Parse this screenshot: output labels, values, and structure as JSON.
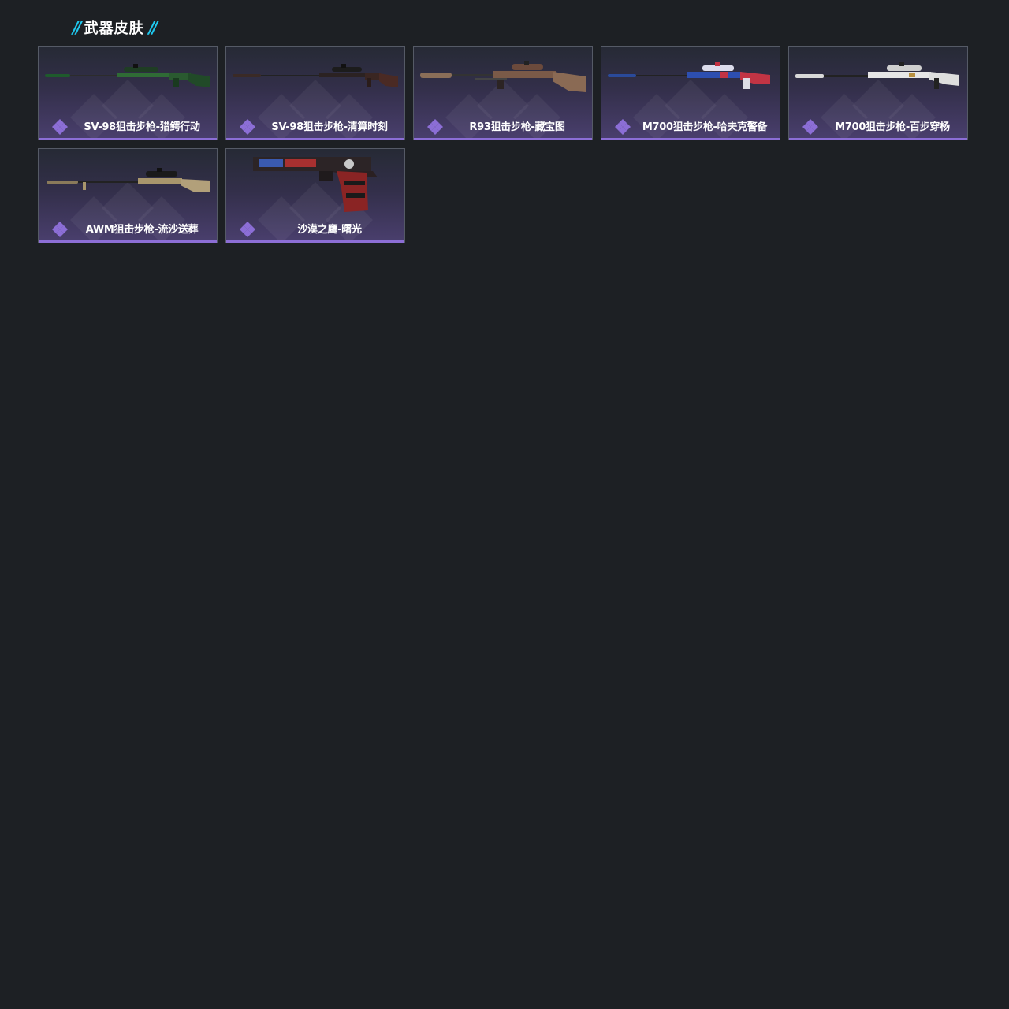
{
  "section": {
    "title": "武器皮肤",
    "deco_left": "//",
    "deco_right": "//",
    "accent_color": "#1ec8ee"
  },
  "rarity_color": "#8c6ed6",
  "skins": [
    {
      "name": "SV-98狙击步枪-猎鳄行动",
      "icon": "sniper-rifle-icon",
      "camo": "green"
    },
    {
      "name": "SV-98狙击步枪-清算时刻",
      "icon": "sniper-rifle-icon",
      "camo": "dark-red"
    },
    {
      "name": "R93狙击步枪-藏宝图",
      "icon": "sniper-rifle-icon",
      "camo": "tan-map"
    },
    {
      "name": "M700狙击步枪-哈夫克警备",
      "icon": "sniper-rifle-icon",
      "camo": "blue-red"
    },
    {
      "name": "M700狙击步枪-百步穿杨",
      "icon": "sniper-rifle-icon",
      "camo": "white-black"
    },
    {
      "name": "AWM狙击步枪-流沙送葬",
      "icon": "sniper-rifle-icon",
      "camo": "sand"
    },
    {
      "name": "沙漠之鹰-曙光",
      "icon": "pistol-icon",
      "camo": "red-dark"
    }
  ]
}
